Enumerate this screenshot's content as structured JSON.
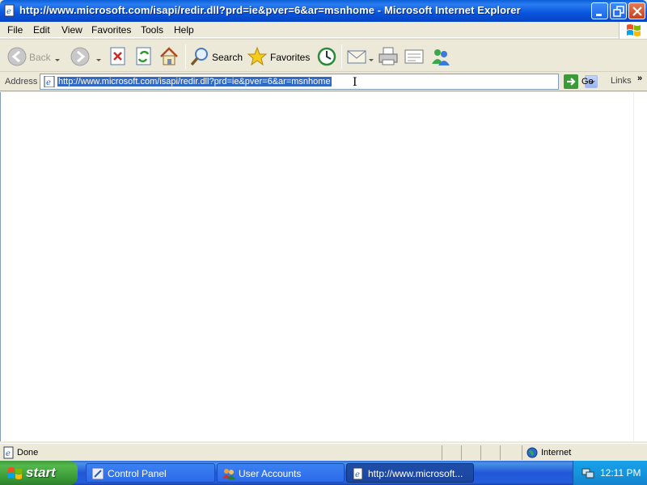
{
  "window": {
    "title": "http://www.microsoft.com/isapi/redir.dll?prd=ie&pver=6&ar=msnhome - Microsoft Internet Explorer"
  },
  "menu": {
    "items": [
      {
        "label": "File"
      },
      {
        "label": "Edit"
      },
      {
        "label": "View"
      },
      {
        "label": "Favorites"
      },
      {
        "label": "Tools"
      },
      {
        "label": "Help"
      }
    ]
  },
  "toolbar": {
    "back_label": "Back",
    "search_label": "Search",
    "favorites_label": "Favorites"
  },
  "address": {
    "label": "Address",
    "url": "http://www.microsoft.com/isapi/redir.dll?prd=ie&pver=6&ar=msnhome",
    "go_label": "Go",
    "links_label": "Links",
    "links_chevron": "»"
  },
  "status": {
    "text": "Done",
    "zone": "Internet"
  },
  "taskbar": {
    "start_label": "start",
    "tasks": [
      {
        "label": "Control Panel",
        "active": false
      },
      {
        "label": "User Accounts",
        "active": false
      },
      {
        "label": "http://www.microsoft...",
        "active": true
      }
    ],
    "clock": "12:11 PM"
  },
  "icons": {
    "title_icon": "ie-page-icon",
    "back": "back-arrow-icon",
    "forward": "forward-arrow-icon",
    "stop": "stop-icon",
    "refresh": "refresh-icon",
    "home": "home-icon",
    "search": "magnifier-icon",
    "favorites": "star-icon",
    "history": "history-icon",
    "mail": "mail-icon",
    "print": "printer-icon",
    "edit": "edit-icon",
    "messenger": "messenger-icon"
  },
  "colors": {
    "title_bar": "#0a5fd8",
    "selection": "#316ac5",
    "start_button": "#3a9a37",
    "taskbar": "#245edb"
  }
}
